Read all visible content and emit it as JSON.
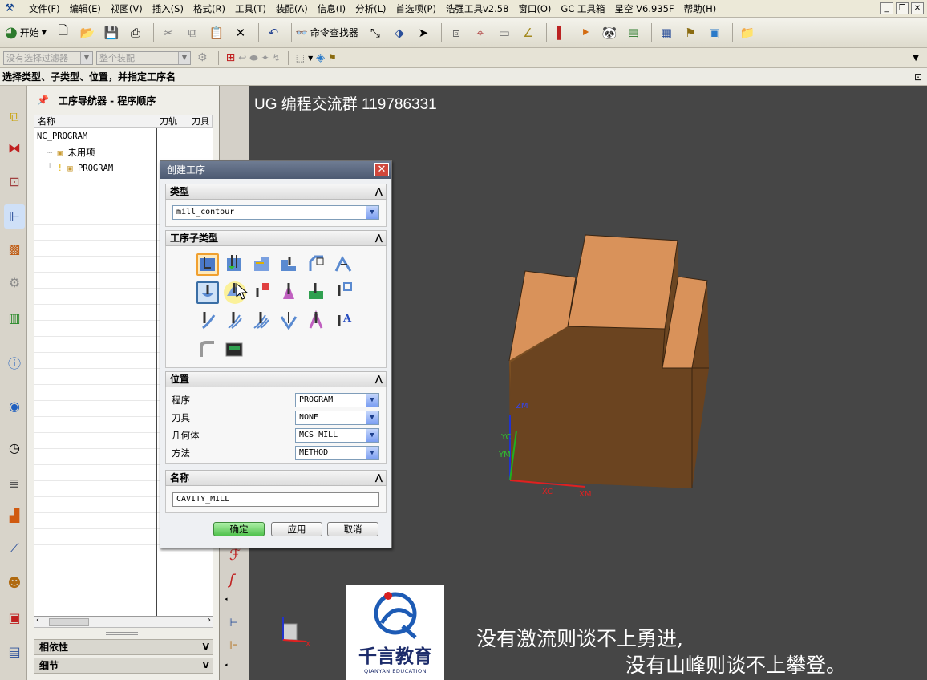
{
  "menubar": {
    "items": [
      "文件(F)",
      "编辑(E)",
      "视图(V)",
      "插入(S)",
      "格式(R)",
      "工具(T)",
      "装配(A)",
      "信息(I)",
      "分析(L)",
      "首选项(P)",
      "浩强工具v2.58",
      "窗口(O)",
      "GC 工具箱",
      "星空 V6.935F",
      "帮助(H)"
    ]
  },
  "toolbar": {
    "start_label": "开始",
    "command_finder_label": "命令查找器"
  },
  "filter_bar": {
    "filter_combo": "没有选择过滤器",
    "assembly_combo": "整个装配"
  },
  "cue_line": "选择类型、子类型、位置，并指定工序名",
  "navigator": {
    "title": "工序导航器 - 程序顺序",
    "columns": [
      "名称",
      "刀轨",
      "刀具"
    ],
    "rows": [
      "NC_PROGRAM",
      "未用项",
      "PROGRAM"
    ],
    "section_dependencies": "相依性",
    "section_details": "细节"
  },
  "viewport": {
    "title_text": "UG 编程交流群 119786331",
    "axis_labels": {
      "zm": "ZM",
      "yc": "YC",
      "ym": "YM",
      "xc": "XC",
      "xm": "XM",
      "x": "X"
    }
  },
  "dialog": {
    "title": "创建工序",
    "type_section": "类型",
    "type_value": "mill_contour",
    "subtype_section": "工序子类型",
    "location_section": "位置",
    "fields": [
      {
        "label": "程序",
        "value": "PROGRAM"
      },
      {
        "label": "刀具",
        "value": "NONE"
      },
      {
        "label": "几何体",
        "value": "MCS_MILL"
      },
      {
        "label": "方法",
        "value": "METHOD"
      }
    ],
    "name_section": "名称",
    "name_value": "CAVITY_MILL",
    "ok_label": "确定",
    "apply_label": "应用",
    "cancel_label": "取消"
  },
  "watermark": {
    "brand_cn": "千言教育",
    "brand_en": "QIANYAN EDUCATION",
    "caption_line1": "没有激流则谈不上勇进,",
    "caption_line2": "没有山峰则谈不上攀登。"
  },
  "colors": {
    "viewport_bg": "#464646",
    "part_top": "#d9925a",
    "part_side": "#7a4f26",
    "part_front": "#6b4420",
    "dialog_header": "#4d5a72",
    "selected_icon": "#f0a030"
  }
}
